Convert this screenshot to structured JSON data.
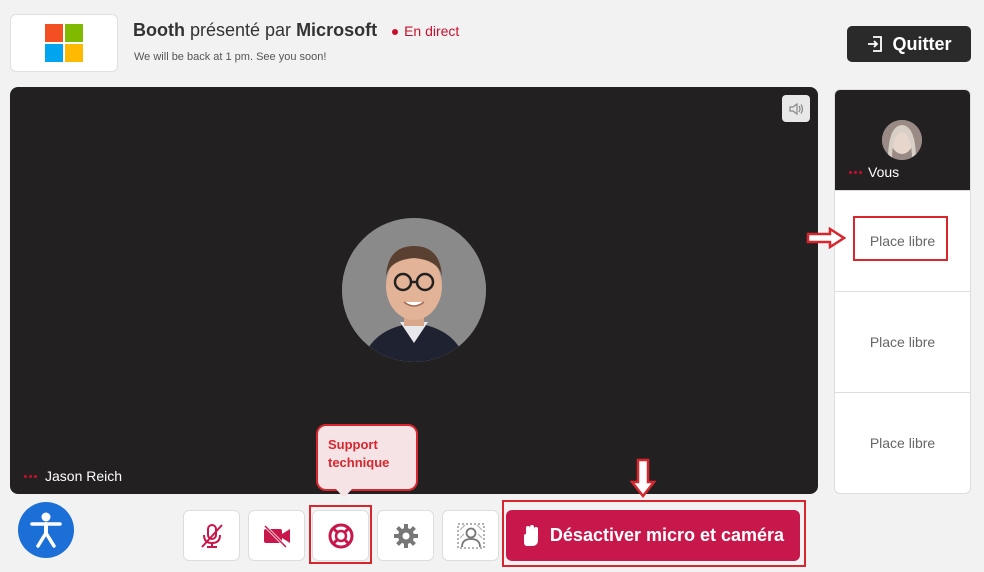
{
  "header": {
    "booth_word": "Booth",
    "presented_by": " présenté par ",
    "company": "Microsoft",
    "live_label": "En direct",
    "subtitle": "We will be back at 1 pm. See you soon!",
    "quit_label": "Quitter"
  },
  "logo": {
    "colors": [
      "#f25022",
      "#7fba00",
      "#00a4ef",
      "#ffb900"
    ]
  },
  "video": {
    "participant_name": "Jason Reich"
  },
  "side_panel": {
    "you_label": "Vous",
    "free_slots": [
      "Place libre",
      "Place libre",
      "Place libre"
    ]
  },
  "toolbar": {
    "mute_icon": "mic-muted-icon",
    "camera_icon": "camera-off-icon",
    "support_icon": "lifebuoy-icon",
    "settings_icon": "gear-icon",
    "background_icon": "background-blur-icon",
    "disable_label": "Désactiver micro et caméra"
  },
  "tooltip": {
    "text": "Support technique"
  },
  "colors": {
    "accent": "#c8174a",
    "annotation": "#d7262e",
    "accessibility": "#1b6fd6"
  }
}
